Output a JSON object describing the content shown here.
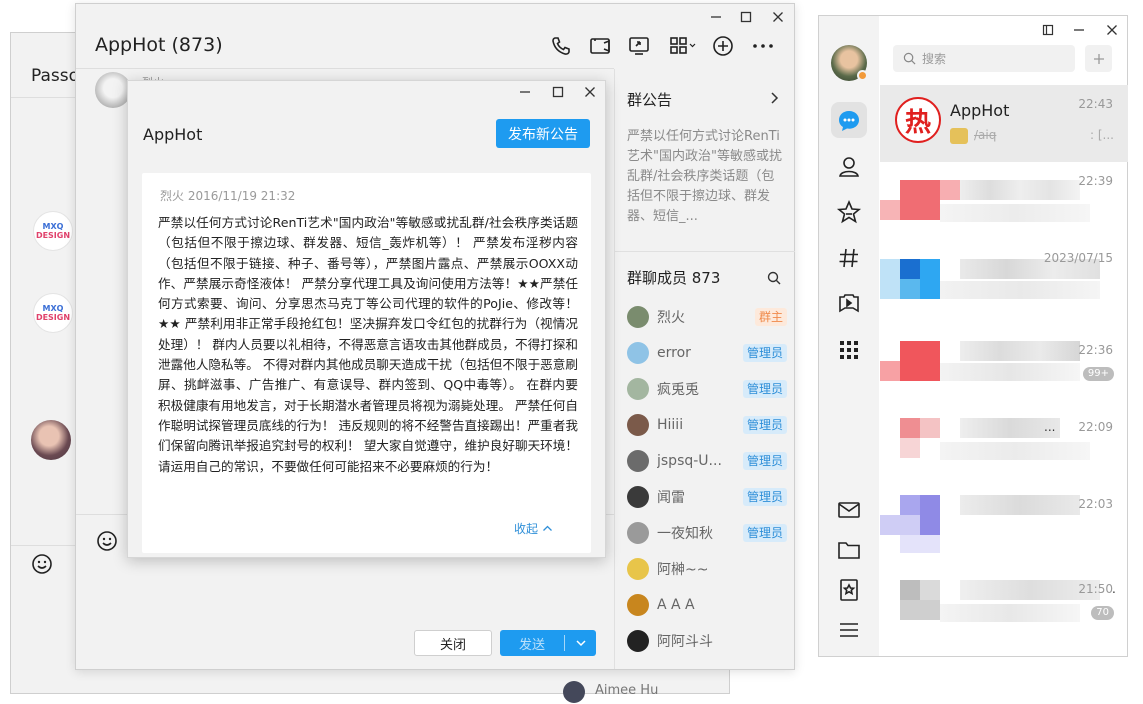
{
  "back_window": {
    "title": "Passo",
    "bottom_name": "Aimee Hu"
  },
  "chat": {
    "title": "AppHot (873)",
    "member_name_partial": "烈火",
    "send_label": "发送",
    "close_label": "关闭",
    "notice": {
      "heading": "群公告",
      "text": "严禁以任何方式讨论RenTi艺术\"国内政治\"等敏感或扰乱群/社会秩序类话题（包括但不限于擦边球、群发器、短信_..."
    },
    "members": {
      "heading": "群聊成员 873",
      "list": [
        {
          "name": "烈火",
          "role": "群主",
          "role_type": "owner",
          "color": "#7a8c6e"
        },
        {
          "name": "error",
          "role": "管理员",
          "role_type": "admin",
          "color": "#8fc3e6"
        },
        {
          "name": "疯兎兎",
          "role": "管理员",
          "role_type": "admin",
          "color": "#a3b6a0"
        },
        {
          "name": "Hiiii",
          "role": "管理员",
          "role_type": "admin",
          "color": "#7b5a4a"
        },
        {
          "name": "jspsq-U...",
          "role": "管理员",
          "role_type": "admin",
          "color": "#6b6b6b"
        },
        {
          "name": "闻雷",
          "role": "管理员",
          "role_type": "admin",
          "color": "#3a3a3a"
        },
        {
          "name": "一夜知秋",
          "role": "管理员",
          "role_type": "admin",
          "color": "#9a9a9a"
        },
        {
          "name": "阿榊~~",
          "role": "",
          "role_type": "",
          "color": "#e8c54a"
        },
        {
          "name": "A A A",
          "role": "",
          "role_type": "",
          "color": "#c8861e"
        },
        {
          "name": "阿阿斗斗",
          "role": "",
          "role_type": "",
          "color": "#222222"
        }
      ]
    }
  },
  "dialog": {
    "title": "AppHot",
    "publish_label": "发布新公告",
    "meta": "烈火 2016/11/19 21:32",
    "body": "严禁以任何方式讨论RenTi艺术\"国内政治\"等敏感或扰乱群/社会秩序类话题（包括但不限于擦边球、群发器、短信_轰炸机等）！ 严禁发布淫秽内容（包括但不限于链接、种子、番号等），严禁图片露点、严禁展示OOXX动作、严禁展示奇怪液体！ 严禁分享代理工具及询问使用方法等！★★严禁任何方式索要、询问、分享思杰马克丁等公司代理的软件的PoJie、修改等！★★ 严禁利用非正常手段抢红包！坚决摒弃发口令红包的扰群行为（视情况处理）！ 群内人员要以礼相待，不得恶意言语攻击其他群成员，不得打探和泄露他人隐私等。 不得对群内其他成员聊天造成干扰（包括但不限于恶意刷屏、挑衅滋事、广告推广、有意误导、群内签到、QQ中毒等）。 在群内要积极健康有用地发言，对于长期潜水者管理员将视为溺毙处理。 严禁任何自作聪明试探管理员底线的行为！ 违反规则的将不经警告直接踢出！严重者我们保留向腾讯举报追究封号的权利！ 望大家自觉遵守，维护良好聊天环境！请运用自己的常识，不要做任何可能招来不必要麻烦的行为！",
    "collapse_label": "收起"
  },
  "main_panel": {
    "search_placeholder": "搜索",
    "conversations": [
      {
        "name": "AppHot",
        "time": "22:43",
        "preview": "/aiq",
        "preview_tail": ": [...",
        "selected": true
      },
      {
        "name": "",
        "time": "22:39",
        "count": ""
      },
      {
        "name": "",
        "time": "2023/07/15",
        "count": ""
      },
      {
        "name": "",
        "time": "22:36",
        "count": "99+"
      },
      {
        "name": "",
        "time": "22:09",
        "count": "",
        "tail": "..."
      },
      {
        "name": "",
        "time": "22:03",
        "count": ""
      },
      {
        "name": "",
        "time": "21:50",
        "count": "70",
        "tail": "."
      }
    ]
  },
  "colors": {
    "accent": "#1e9bf0",
    "owner_badge": "#f08a4b",
    "admin_badge": "#2f8fd8",
    "apphot_red": "#e0201f"
  }
}
